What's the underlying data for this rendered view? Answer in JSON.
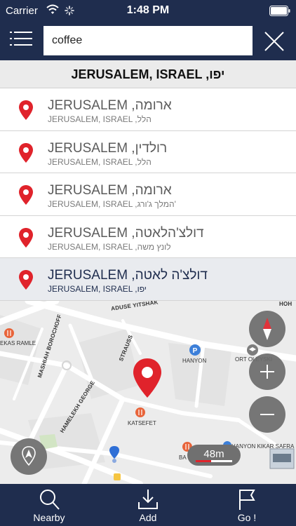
{
  "status_bar": {
    "carrier": "Carrier",
    "time": "1:48 PM"
  },
  "search": {
    "value": "coffee"
  },
  "city_header": "JERUSALEM, ISRAEL ,יפו",
  "results": [
    {
      "title": "JERUSALEM ,ארומה",
      "subtitle": "JERUSALEM, ISRAEL ,הלל"
    },
    {
      "title": "JERUSALEM ,רולדין",
      "subtitle": "JERUSALEM, ISRAEL ,הלל"
    },
    {
      "title": "JERUSALEM ,ארומה",
      "subtitle": "JERUSALEM, ISRAEL ,המלך ג'ורג'"
    },
    {
      "title": "JERUSALEM ,דולצ'הלאטה",
      "subtitle": "JERUSALEM, ISRAEL ,לונץ משה"
    },
    {
      "title": "JERUSALEM ,דולצ'ה לאטה",
      "subtitle": "JERUSALEM, ISRAEL ,יפו"
    }
  ],
  "map": {
    "streets": [
      "ADUSE YITSHAK",
      "HOH",
      "MASHIAH BOROCHOFF",
      "STRAUSS",
      "HAMELEKH GEORGE"
    ],
    "pois": [
      "EKAS RAMLE",
      "HANYON",
      "ORT OLEYSKI",
      "KATSEFET",
      "BA",
      "HANYON KIKAR SAFRA"
    ],
    "scale": "48m"
  },
  "tabs": [
    {
      "label": "Nearby",
      "icon": "search-icon"
    },
    {
      "label": "Add",
      "icon": "download-icon"
    },
    {
      "label": "Go !",
      "icon": "flag-icon"
    }
  ],
  "colors": {
    "navy": "#1f2d4e",
    "pin_red": "#e0232b",
    "selected_row": "#e9ebef"
  }
}
